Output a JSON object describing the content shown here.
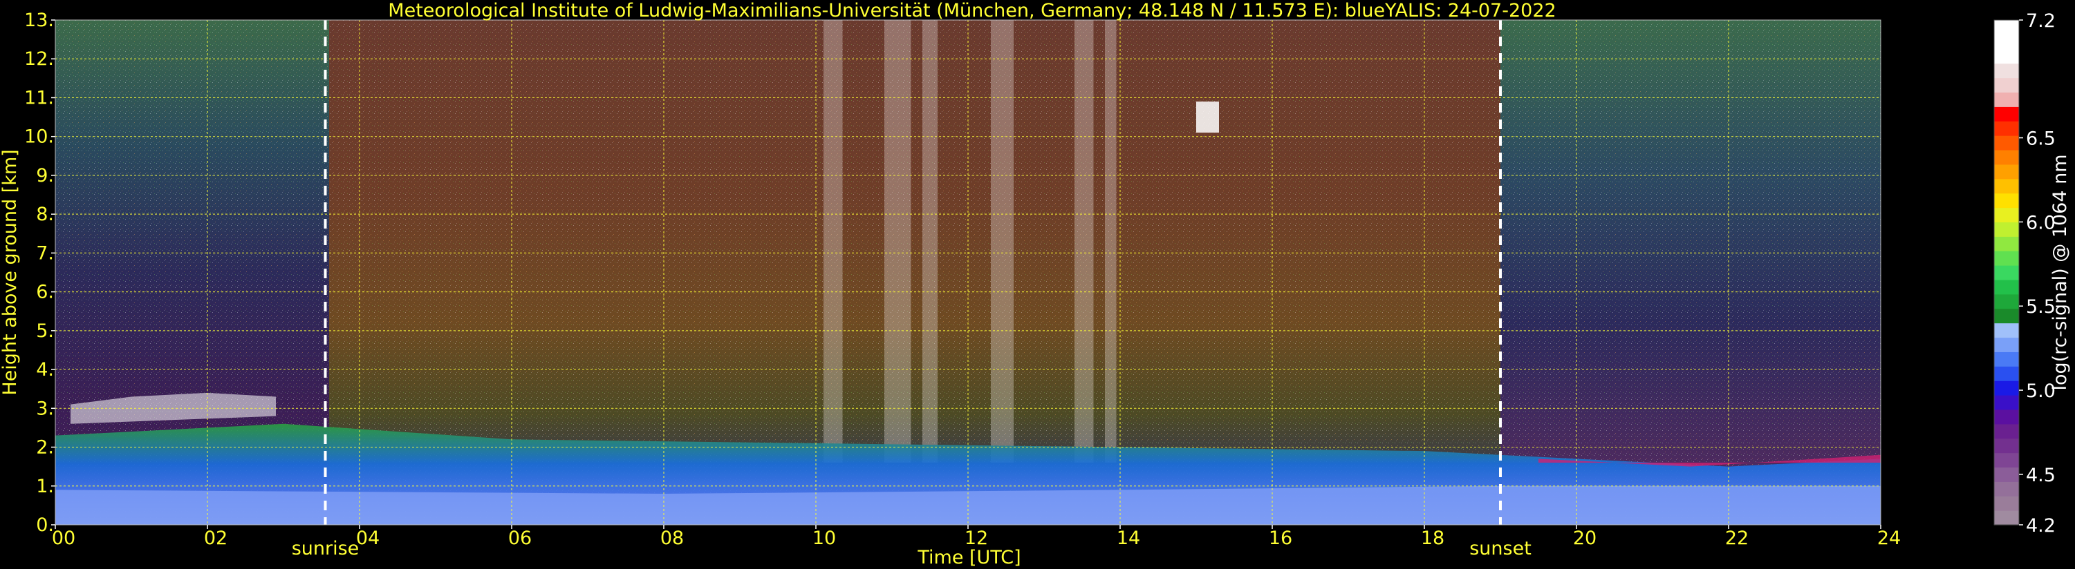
{
  "chart_data": {
    "type": "heatmap",
    "title": "Meteorological Institute of Ludwig-Maximilians-Universität (München, Germany; 48.148 N / 11.573 E):     blueYALIS: 24-07-2022",
    "xlabel": "Time [UTC]",
    "ylabel": "Height above ground [km]",
    "xlim": [
      0,
      24
    ],
    "ylim": [
      0,
      13
    ],
    "x_ticks": [
      {
        "value": 0,
        "label": "00"
      },
      {
        "value": 2,
        "label": "02"
      },
      {
        "value": 4,
        "label": "04"
      },
      {
        "value": 6,
        "label": "06"
      },
      {
        "value": 8,
        "label": "08"
      },
      {
        "value": 10,
        "label": "10"
      },
      {
        "value": 12,
        "label": "12"
      },
      {
        "value": 14,
        "label": "14"
      },
      {
        "value": 16,
        "label": "16"
      },
      {
        "value": 18,
        "label": "18"
      },
      {
        "value": 20,
        "label": "20"
      },
      {
        "value": 22,
        "label": "22"
      },
      {
        "value": 24,
        "label": "24"
      }
    ],
    "y_ticks": [
      {
        "value": 0,
        "label": "0."
      },
      {
        "value": 1,
        "label": "1."
      },
      {
        "value": 2,
        "label": "2."
      },
      {
        "value": 3,
        "label": "3."
      },
      {
        "value": 4,
        "label": "4."
      },
      {
        "value": 5,
        "label": "5."
      },
      {
        "value": 6,
        "label": "6."
      },
      {
        "value": 7,
        "label": "7."
      },
      {
        "value": 8,
        "label": "8."
      },
      {
        "value": 9,
        "label": "9."
      },
      {
        "value": 10,
        "label": "10."
      },
      {
        "value": 11,
        "label": "11."
      },
      {
        "value": 12,
        "label": "12."
      },
      {
        "value": 13,
        "label": "13."
      }
    ],
    "grid": true,
    "annotations": [
      {
        "label": "sunrise",
        "time": 3.55
      },
      {
        "label": "sunset",
        "time": 19.0
      }
    ],
    "colorbar": {
      "label": "log(rc-signal) @ 1064 nm",
      "range": [
        4.2,
        7.2
      ],
      "ticks": [
        {
          "value": 4.2,
          "label": "4.2"
        },
        {
          "value": 4.5,
          "label": "4.5"
        },
        {
          "value": 5.0,
          "label": "5.0"
        },
        {
          "value": 5.5,
          "label": "5.5"
        },
        {
          "value": 6.0,
          "label": "6.0"
        },
        {
          "value": 6.5,
          "label": "6.5"
        },
        {
          "value": 7.2,
          "label": "7.2"
        }
      ],
      "colors": [
        "#a08ba0",
        "#9a7d9a",
        "#94709a",
        "#8b5d99",
        "#7f4594",
        "#73308f",
        "#6a2090",
        "#5b10a0",
        "#3a10c8",
        "#1a1ae6",
        "#2a50f0",
        "#4a7af5",
        "#7aa0f8",
        "#a0c0fa",
        "#1a8a2a",
        "#1ea83a",
        "#22c04a",
        "#3ad860",
        "#60e050",
        "#90e840",
        "#c0f030",
        "#e8f020",
        "#ffe000",
        "#ffc000",
        "#ffa000",
        "#ff8000",
        "#ff5a00",
        "#ff3000",
        "#ff0000",
        "#f0b0b0",
        "#f0d0d0",
        "#f0e0e0",
        "#ffffff",
        "#ffffff",
        "#ffffff"
      ]
    }
  }
}
